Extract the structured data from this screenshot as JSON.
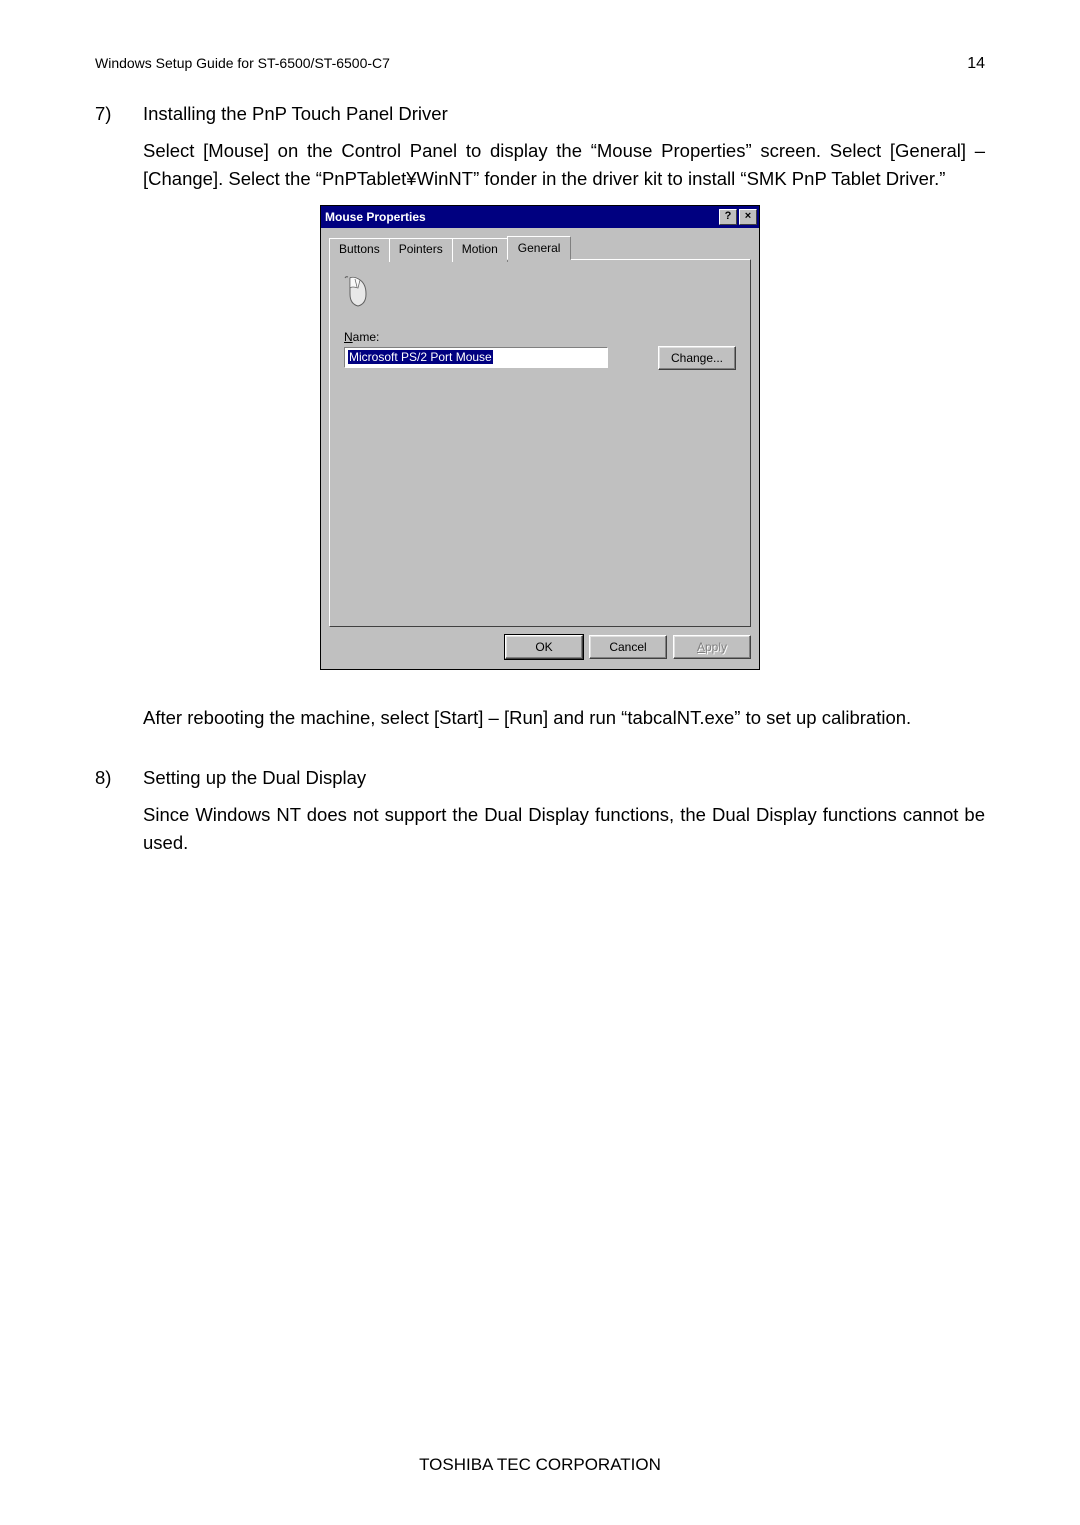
{
  "header": {
    "doc_title": "Windows Setup Guide for ST-6500/ST-6500-C7",
    "page_number": "14"
  },
  "section7": {
    "number": "7)",
    "title": "Installing the PnP Touch Panel Driver",
    "para1": "Select [Mouse] on the Control Panel to display the “Mouse Properties” screen.  Select [General] – [Change].  Select the “PnPTablet¥WinNT” fonder in the driver kit to install “SMK PnP Tablet Driver.”",
    "para2": "After rebooting the machine, select [Start] – [Run] and run “tabcalNT.exe” to set up calibration."
  },
  "dialog": {
    "title": "Mouse Properties",
    "help_btn": "?",
    "close_btn": "×",
    "tabs": {
      "buttons": "Buttons",
      "pointers": "Pointers",
      "motion": "Motion",
      "general": "General"
    },
    "name_label_underline": "N",
    "name_label_rest": "ame:",
    "name_value": "Microsoft PS/2 Port Mouse",
    "change_btn_underline": "C",
    "change_btn_rest": "hange...",
    "ok_btn": "OK",
    "cancel_btn": "Cancel",
    "apply_btn_underline": "A",
    "apply_btn_rest": "pply"
  },
  "section8": {
    "number": "8)",
    "title": "Setting up the Dual Display",
    "para1": "Since Windows NT does not support the Dual Display functions, the Dual Display functions cannot be used."
  },
  "footer": "TOSHIBA TEC CORPORATION"
}
